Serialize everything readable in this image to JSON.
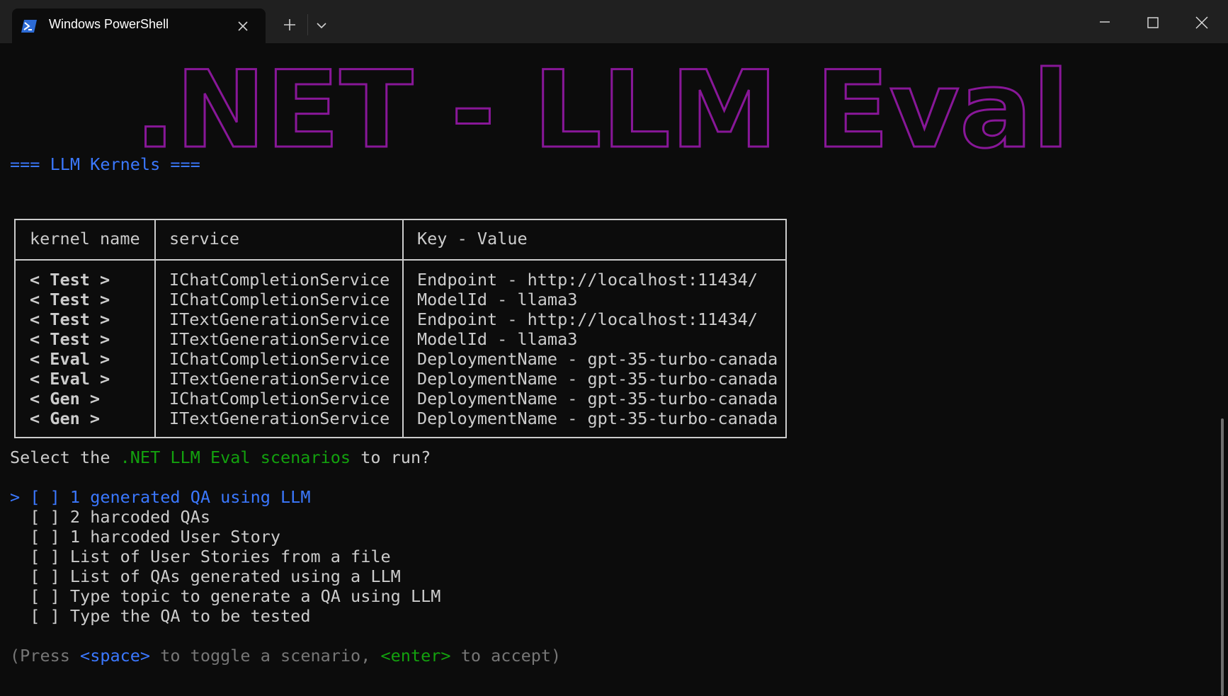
{
  "window": {
    "tab_title": "Windows PowerShell",
    "icons": {
      "tab": "powershell-icon",
      "close_tab": "close-icon",
      "new_tab": "plus-icon",
      "dropdown": "chevron-down-icon",
      "minimize": "minimize-icon",
      "maximize": "maximize-icon",
      "close": "close-icon"
    }
  },
  "banner": {
    "text": ".NET - LLM Eval",
    "color": "#881798"
  },
  "section_header": "=== LLM Kernels ===",
  "table": {
    "headers": [
      "kernel name",
      "service",
      "Key - Value"
    ],
    "rows": [
      [
        "< Test >",
        "IChatCompletionService",
        "Endpoint - http://localhost:11434/"
      ],
      [
        "< Test >",
        "IChatCompletionService",
        "ModelId - llama3"
      ],
      [
        "< Test >",
        "ITextGenerationService",
        "Endpoint - http://localhost:11434/"
      ],
      [
        "< Test >",
        "ITextGenerationService",
        "ModelId - llama3"
      ],
      [
        "< Eval >",
        "IChatCompletionService",
        "DeploymentName - gpt-35-turbo-canada"
      ],
      [
        "< Eval >",
        "ITextGenerationService",
        "DeploymentName - gpt-35-turbo-canada"
      ],
      [
        "< Gen >",
        "IChatCompletionService",
        "DeploymentName - gpt-35-turbo-canada"
      ],
      [
        "< Gen >",
        "ITextGenerationService",
        "DeploymentName - gpt-35-turbo-canada"
      ]
    ]
  },
  "prompt": {
    "before": "Select the ",
    "highlight": ".NET LLM Eval scenarios",
    "after": " to run?"
  },
  "scenarios": {
    "cursor": ">",
    "items": [
      {
        "checkbox": "[ ]",
        "label": "1 generated QA using LLM",
        "active": true
      },
      {
        "checkbox": "[ ]",
        "label": "2 harcoded QAs",
        "active": false
      },
      {
        "checkbox": "[ ]",
        "label": "1 harcoded User Story",
        "active": false
      },
      {
        "checkbox": "[ ]",
        "label": "List of User Stories from a file",
        "active": false
      },
      {
        "checkbox": "[ ]",
        "label": "List of QAs generated using a LLM",
        "active": false
      },
      {
        "checkbox": "[ ]",
        "label": "Type topic to generate a QA using LLM",
        "active": false
      },
      {
        "checkbox": "[ ]",
        "label": "Type the QA to be tested",
        "active": false
      }
    ]
  },
  "hint": {
    "p1": "(Press ",
    "k1": "<space>",
    "p2": " to toggle a scenario, ",
    "k2": "<enter>",
    "p3": " to accept)"
  },
  "colors": {
    "blue": "#3b78ff",
    "green": "#13a10e",
    "magenta": "#881798",
    "gray": "#767676",
    "text": "#cccccc",
    "background": "#0c0c0c"
  }
}
